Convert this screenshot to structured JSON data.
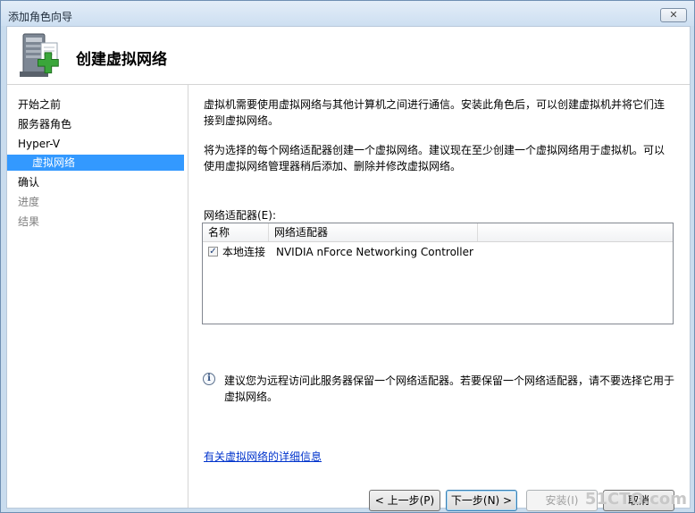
{
  "window": {
    "title": "添加角色向导",
    "close_label": "✕"
  },
  "header": {
    "title": "创建虚拟网络"
  },
  "sidebar": {
    "items": [
      {
        "label": "开始之前",
        "state": "normal"
      },
      {
        "label": "服务器角色",
        "state": "normal"
      },
      {
        "label": "Hyper-V",
        "state": "normal"
      },
      {
        "label": "虚拟网络",
        "state": "selected"
      },
      {
        "label": "确认",
        "state": "normal"
      },
      {
        "label": "进度",
        "state": "disabled"
      },
      {
        "label": "结果",
        "state": "disabled"
      }
    ]
  },
  "main": {
    "para1": "虚拟机需要使用虚拟网络与其他计算机之间进行通信。安装此角色后，可以创建虚拟机并将它们连接到虚拟网络。",
    "para2": "将为选择的每个网络适配器创建一个虚拟网络。建议现在至少创建一个虚拟网络用于虚拟机。可以使用虚拟网络管理器稍后添加、删除并修改虚拟网络。",
    "adapter_label": "网络适配器(E):",
    "table": {
      "columns": [
        "名称",
        "网络适配器"
      ],
      "rows": [
        {
          "checked": true,
          "name": "本地连接",
          "adapter": "NVIDIA nForce Networking Controller"
        }
      ]
    },
    "info_text": "建议您为远程访问此服务器保留一个网络适配器。若要保留一个网络适配器，请不要选择它用于虚拟网络。",
    "link": "有关虚拟网络的详细信息"
  },
  "buttons": {
    "prev": "< 上一步(P)",
    "next": "下一步(N) >",
    "install": "安装(I)",
    "cancel": "取消"
  },
  "watermark": "51CTO.com",
  "colors": {
    "selection": "#3399ff",
    "link": "#0033cc",
    "frame": "#c9dcee"
  }
}
